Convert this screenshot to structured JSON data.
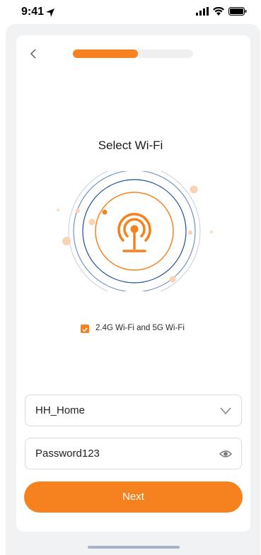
{
  "status_bar": {
    "time": "9:41"
  },
  "progress": {
    "fraction": 0.54
  },
  "title": "Select Wi-Fi",
  "option": {
    "label": "2.4G Wi-Fi and 5G Wi-Fi",
    "checked": true
  },
  "wifi_select": {
    "value": "HH_Home"
  },
  "password": {
    "value": "Password123"
  },
  "next_button": {
    "label": "Next"
  },
  "colors": {
    "accent": "#f5821f",
    "ring": "#1f4f9a"
  }
}
